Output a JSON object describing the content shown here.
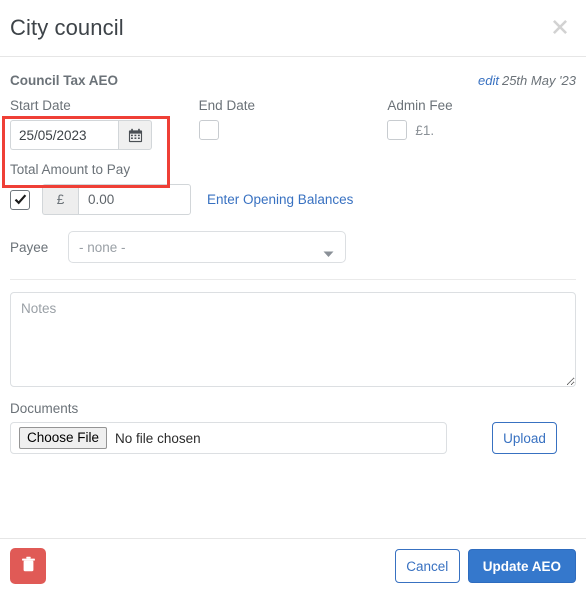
{
  "header": {
    "title": "City council",
    "close_icon": "close-icon"
  },
  "section": {
    "title": "Council Tax AEO",
    "edit_label": "edit",
    "date_label": "25th May '23"
  },
  "fields": {
    "start_date": {
      "label": "Start Date",
      "value": "25/05/2023",
      "calendar_icon": "calendar-icon"
    },
    "end_date": {
      "label": "End Date",
      "checked": false
    },
    "admin_fee": {
      "label": "Admin Fee",
      "checked": false,
      "amount_text": "£1."
    },
    "total_amount": {
      "label": "Total Amount to Pay",
      "checked": true,
      "currency_symbol": "£",
      "value": "0.00",
      "link_label": "Enter Opening Balances"
    },
    "payee": {
      "label": "Payee",
      "selected": "- none -",
      "caret_icon": "chevron-down-icon"
    },
    "notes": {
      "value": "",
      "placeholder": "Notes"
    },
    "documents": {
      "label": "Documents",
      "choose_file_label": "Choose File",
      "file_status": "No file chosen",
      "upload_label": "Upload"
    }
  },
  "footer": {
    "delete_icon": "trash-icon",
    "cancel_label": "Cancel",
    "submit_label": "Update AEO"
  },
  "colors": {
    "accent_blue": "#3578cc",
    "link_blue": "#3871c1",
    "danger_red": "#e05a56",
    "highlight_red": "#ef3f36"
  }
}
